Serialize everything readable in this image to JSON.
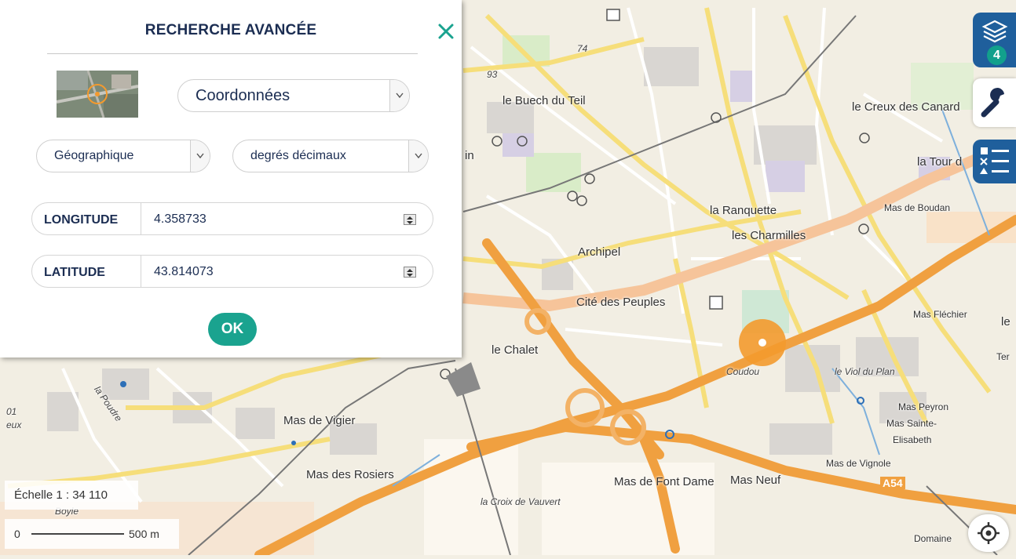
{
  "panel": {
    "title": "RECHERCHE AVANCÉE",
    "close_icon": "close-icon",
    "search_type": "Coordonnées",
    "system": "Géographique",
    "format": "degrés décimaux",
    "longitude_label": "LONGITUDE",
    "longitude_value": "4.358733",
    "latitude_label": "LATITUDE",
    "latitude_value": "43.814073",
    "ok_label": "OK"
  },
  "controls": {
    "layers_count": "4",
    "layers_icon": "layers-icon",
    "tools_icon": "wrench-icon",
    "legend_icon": "legend-list-icon",
    "locate_icon": "locate-crosshair-icon"
  },
  "scale": {
    "ratio": "Échelle 1 : 34 110",
    "zero": "0",
    "distance": "500 m"
  },
  "map_labels": {
    "buech": "le Buech du Teil",
    "creux": "le Creux des Canard",
    "tour": "la Tour d",
    "ranquette": "la Ranquette",
    "charmilles": "les Charmilles",
    "boudan": "Mas de Boudan",
    "archipel": "Archipel",
    "cite": "Cité des Peuples",
    "flechier": "Mas Fléchier",
    "chalet": "le Chalet",
    "coudou": "Coudou",
    "viol": "le Viol du Plan",
    "peyron": "Mas Peyron",
    "sainte": "Mas Sainte-",
    "elisabeth": "Elisabeth",
    "vigier": "Mas de Vigier",
    "rosiers": "Mas des Rosiers",
    "vignole": "Mas de Vignole",
    "fontdame": "Mas de Font Dame",
    "masneuf": "Mas Neuf",
    "a54": "A54",
    "croix": "la Croix de Vauvert",
    "domaine": "Domaine",
    "poudre": "la Poudre",
    "ter": "Ter",
    "les": "le",
    "in": "in",
    "boyle": "Boyle",
    "n74": "74",
    "n93": "93",
    "n01": "01",
    "eux": "eux"
  },
  "colors": {
    "title": "#1b2d52",
    "ok": "#1aa38f",
    "control_blue": "#1f5f9c",
    "highway": "#f0a040",
    "marker": "#f39a2e"
  }
}
